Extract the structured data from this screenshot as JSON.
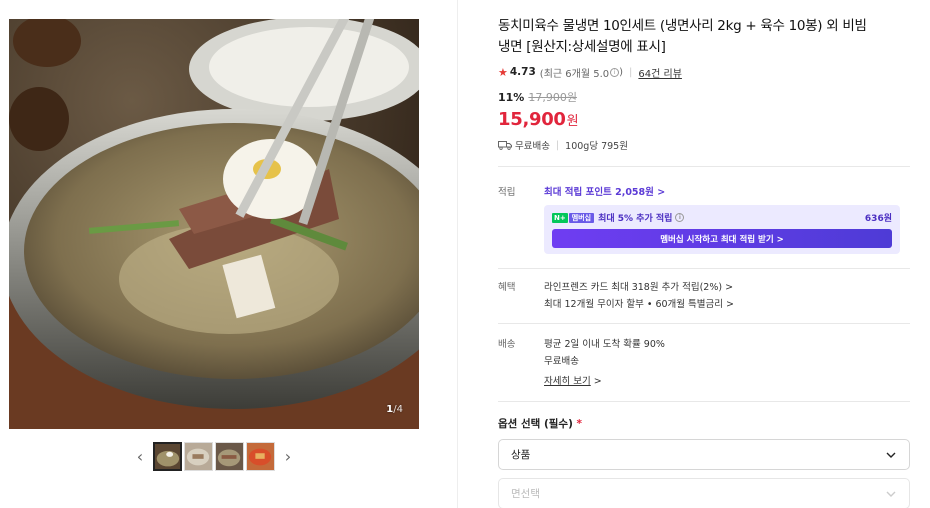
{
  "gallery": {
    "counter_current": "1",
    "counter_total": "/4",
    "prev_arrow": "‹",
    "next_arrow": "›",
    "thumbnails": [
      "thumb-1",
      "thumb-2",
      "thumb-3",
      "thumb-4"
    ]
  },
  "product": {
    "title": "동치미육수 물냉면 10인세트 (냉면사리 2kg + 육수 10봉) 외 비빔냉면 [원산지:상세설명에 표시]",
    "rating_score": "4.73",
    "rating_detail": "(최근 6개월 5.0",
    "rating_detail_end": ")",
    "review_link": "64건 리뷰",
    "discount_rate": "11%",
    "original_price": "17,900원",
    "sale_price": "15,900",
    "sale_currency": "원",
    "shipping": "무료배송",
    "unit_price": "100g당 795원"
  },
  "points": {
    "label": "적립",
    "max_points_link": "최대 적립 포인트 2,058원 >",
    "member_badge_n": "N+",
    "member_badge_m": "멤버십",
    "member_extra": "최대 5% 추가 적립",
    "member_amount": "636원",
    "member_button": "멤버십 시작하고 최대 적립 받기 >"
  },
  "benefits": {
    "label": "혜택",
    "line1": "라인프렌즈 카드 최대 318원 추가 적립(2%) >",
    "line2": "최대 12개월 무이자 할부 • 60개월 특별금리 >"
  },
  "delivery": {
    "label": "배송",
    "line1": "평균 2일 이내 도착 확률 90%",
    "line2": "무료배송",
    "detail_link": "자세히 보기",
    "detail_arrow": ">"
  },
  "options": {
    "title": "옵션 선택 (필수)",
    "required_mark": "*",
    "select1": "상품",
    "select2": "면선택"
  },
  "colors": {
    "price_red": "#e1253c",
    "membership_purple": "#5b3ad6",
    "naver_green": "#03c75a"
  }
}
